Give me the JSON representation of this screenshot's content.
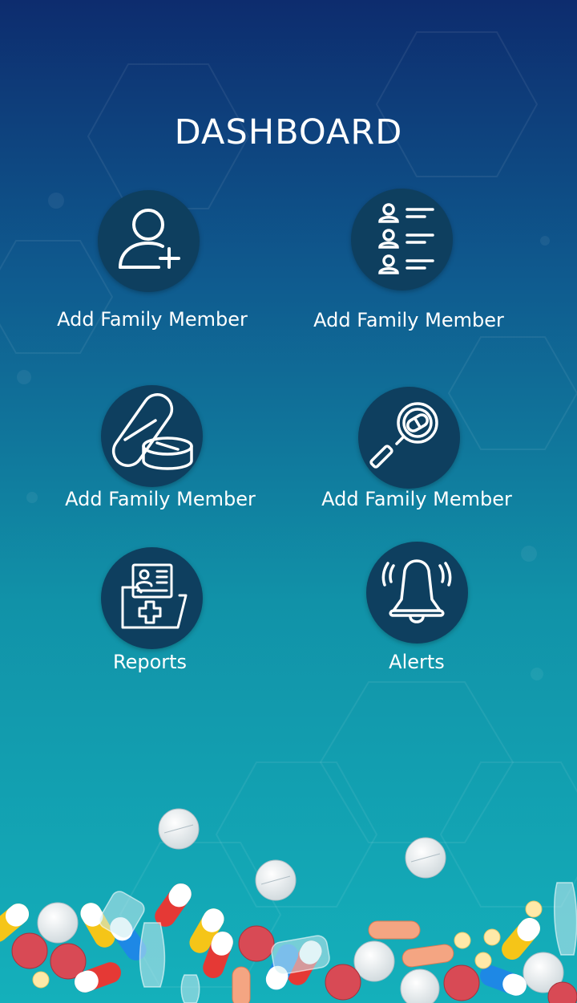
{
  "header": {
    "title": "DASHBOARD"
  },
  "tiles": [
    {
      "label": "Add Family Member",
      "icon": "add-user-icon"
    },
    {
      "label": "Add Family Member",
      "icon": "member-list-icon"
    },
    {
      "label": "Add Family Member",
      "icon": "pills-icon"
    },
    {
      "label": "Add Family Member",
      "icon": "medicine-search-icon"
    },
    {
      "label": "Reports",
      "icon": "medical-folder-icon"
    },
    {
      "label": "Alerts",
      "icon": "ringing-bell-icon"
    }
  ],
  "colors": {
    "circle": "#0e3f5f",
    "gradient_top": "#0d2c6e",
    "gradient_bottom": "#14b0bb",
    "icon_stroke": "#ffffff"
  }
}
